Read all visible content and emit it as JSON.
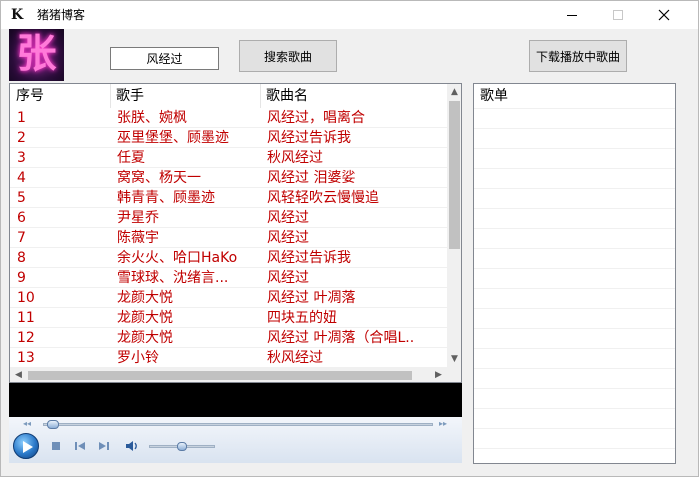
{
  "window": {
    "title": "猪猪博客",
    "app_icon_glyph": "K",
    "controls": {
      "minimize": "minimize-icon",
      "maximize": "maximize-icon",
      "close": "close-icon"
    }
  },
  "avatar": {
    "glyph": "张"
  },
  "search": {
    "value": "风经过",
    "button_label": "搜索歌曲"
  },
  "download": {
    "button_label": "下载播放中歌曲"
  },
  "song_list": {
    "columns": [
      "序号",
      "歌手",
      "歌曲名"
    ],
    "rows": [
      [
        "1",
        "张朕、婉枫",
        "风经过，唱离合"
      ],
      [
        "2",
        "巫里堡堡、顾墨迹",
        "风经过告诉我"
      ],
      [
        "3",
        "任夏",
        "秋风经过"
      ],
      [
        "4",
        "窝窝、杨天一",
        "风经过 泪婆娑"
      ],
      [
        "5",
        "韩青青、顾墨迹",
        "风轻轻吹云慢慢追"
      ],
      [
        "6",
        "尹星乔",
        "风经过"
      ],
      [
        "7",
        "陈薇宇",
        "风经过"
      ],
      [
        "8",
        "余火火、哈口HaKo",
        "风经过告诉我"
      ],
      [
        "9",
        "雪球球、沈绪言...",
        "风经过"
      ],
      [
        "10",
        "龙颜大悦",
        "风经过 叶凋落"
      ],
      [
        "11",
        "龙颜大悦",
        "四块五的妞"
      ],
      [
        "12",
        "龙颜大悦",
        "风经过 叶凋落（合唱L.."
      ],
      [
        "13",
        "罗小铃",
        "秋风经过"
      ]
    ],
    "text_color": "#c00000",
    "scroll": {
      "up": "▲",
      "down": "▼",
      "left": "◀",
      "right": "▶"
    }
  },
  "player": {
    "seek_progress": 0.02,
    "volume_level": 0.5,
    "icons": [
      "play-icon",
      "stop-icon",
      "previous-icon",
      "next-icon",
      "volume-icon"
    ],
    "seek_arrows": {
      "back": "◂◂",
      "fwd": "▸▸"
    }
  },
  "playlist": {
    "header": "歌单"
  }
}
